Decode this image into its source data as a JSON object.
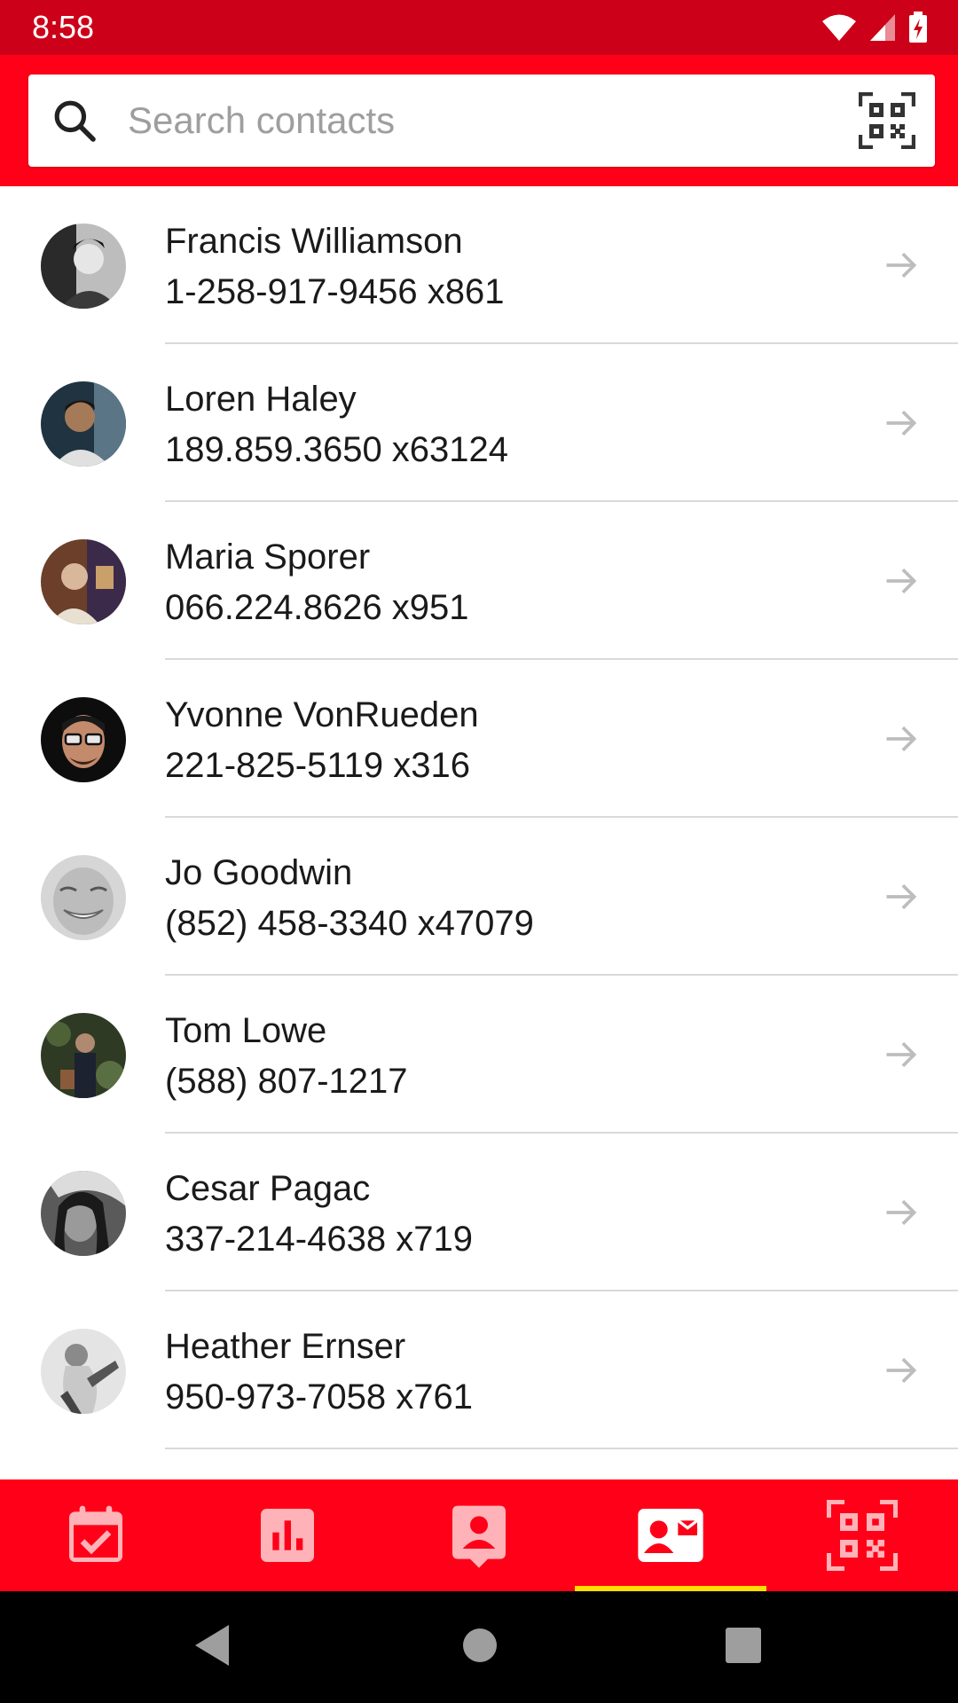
{
  "status_bar": {
    "time": "8:58"
  },
  "search": {
    "placeholder": "Search contacts",
    "value": ""
  },
  "contacts": [
    {
      "name": "Francis Williamson",
      "phone": "1-258-917-9456 x861"
    },
    {
      "name": "Loren Haley",
      "phone": "189.859.3650 x63124"
    },
    {
      "name": "Maria Sporer",
      "phone": "066.224.8626 x951"
    },
    {
      "name": "Yvonne VonRueden",
      "phone": "221-825-5119 x316"
    },
    {
      "name": "Jo Goodwin",
      "phone": "(852) 458-3340 x47079"
    },
    {
      "name": "Tom Lowe",
      "phone": "(588) 807-1217"
    },
    {
      "name": "Cesar Pagac",
      "phone": "337-214-4638 x719"
    },
    {
      "name": "Heather Ernser",
      "phone": "950-973-7058 x761"
    }
  ],
  "bottom_nav": {
    "items": [
      "calendar-check-icon",
      "bar-chart-icon",
      "contact-badge-icon",
      "contact-card-mail-icon",
      "qr-code-icon"
    ],
    "active_index": 3
  },
  "colors": {
    "brand_red": "#ff0018",
    "status_bar_red": "#cc0018",
    "active_indicator": "#ffdd00"
  }
}
